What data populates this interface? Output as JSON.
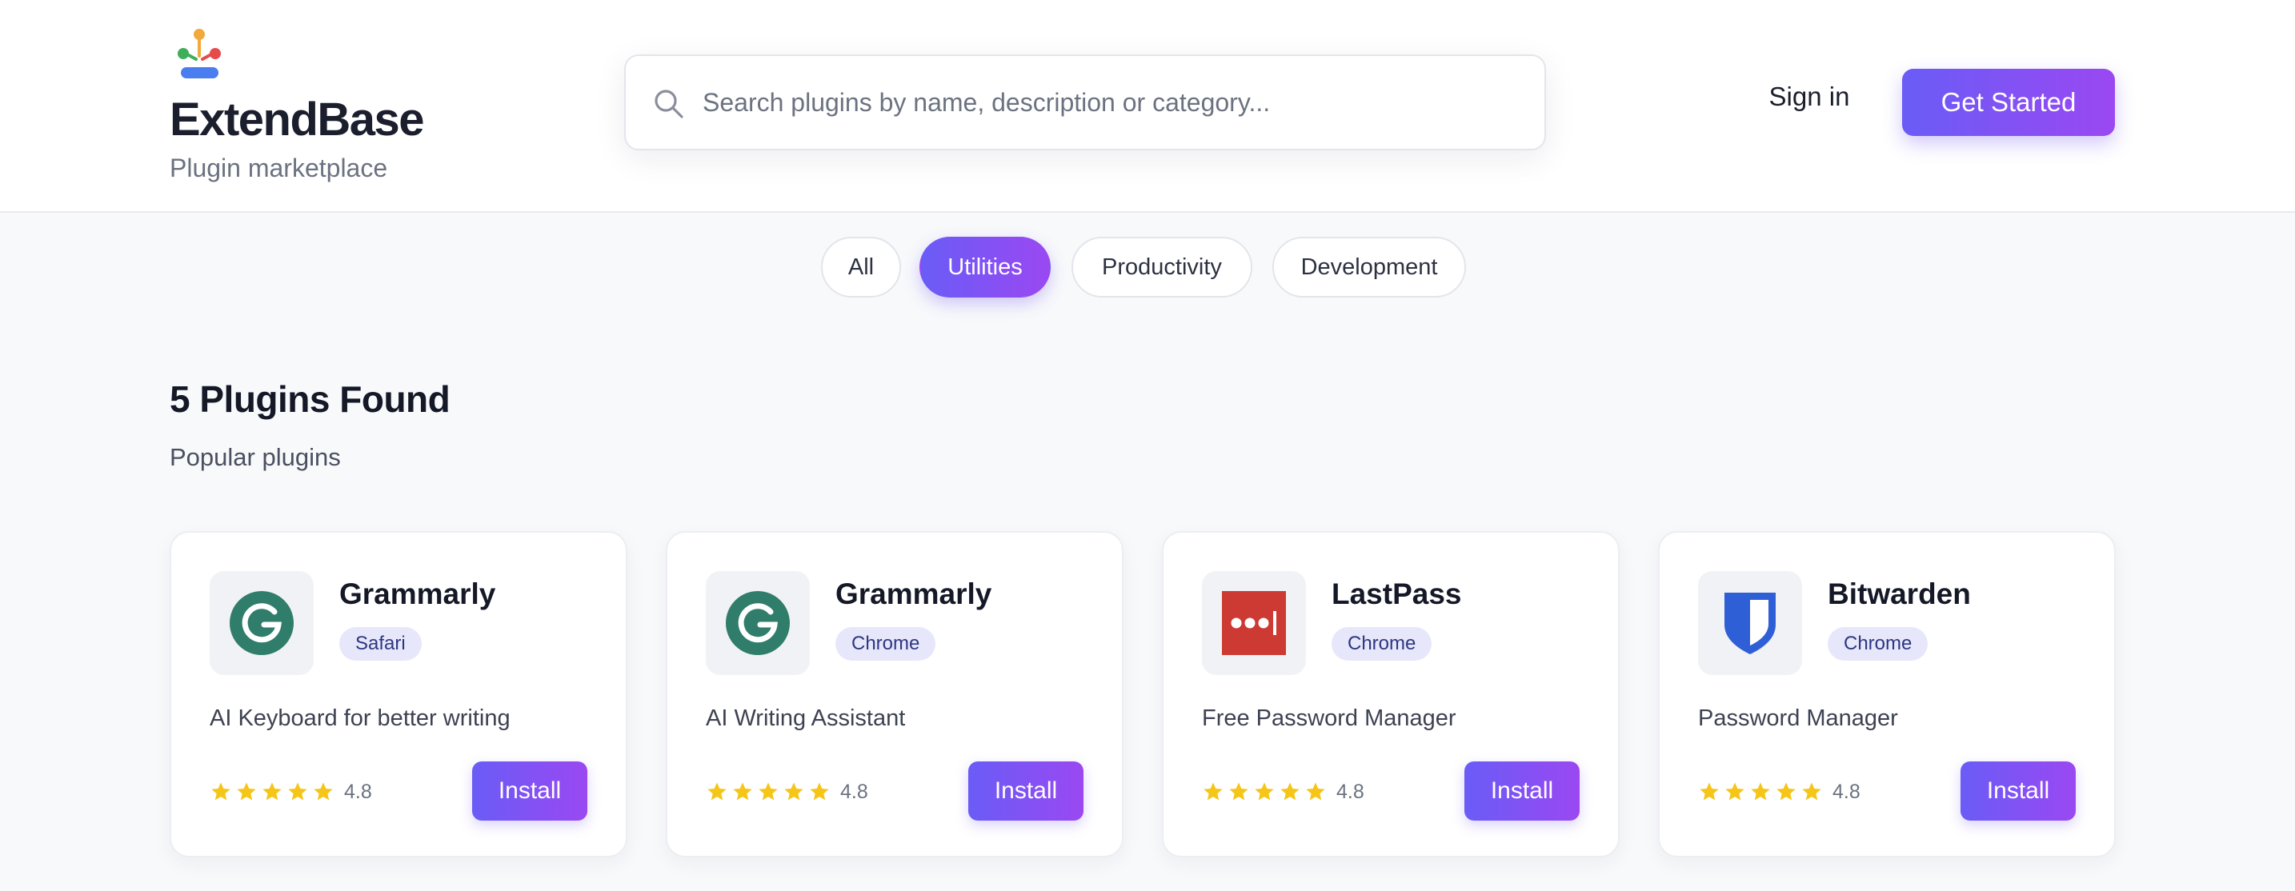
{
  "brand": {
    "name": "ExtendBase",
    "subtitle": "Plugin marketplace",
    "logo_icon": "marketplace-logo-icon"
  },
  "search": {
    "placeholder": "Search plugins by name, description or category...",
    "value": "",
    "icon": "search-icon"
  },
  "nav": {
    "sign_in": "Sign in",
    "get_started": "Get Started"
  },
  "filters": [
    {
      "label": "All",
      "active": false
    },
    {
      "label": "Utilities",
      "active": true
    },
    {
      "label": "Productivity",
      "active": false
    },
    {
      "label": "Development",
      "active": false
    }
  ],
  "results": {
    "title": "5 Plugins Found",
    "subtitle": "Popular plugins"
  },
  "plugins": [
    {
      "name": "Grammarly",
      "browser": "Safari",
      "description": "AI Keyboard for better writing",
      "rating": "4.8",
      "stars": 5,
      "install_label": "Install",
      "icon": "grammarly-icon"
    },
    {
      "name": "Grammarly",
      "browser": "Chrome",
      "description": "AI Writing Assistant",
      "rating": "4.8",
      "stars": 5,
      "install_label": "Install",
      "icon": "grammarly-icon"
    },
    {
      "name": "LastPass",
      "browser": "Chrome",
      "description": "Free Password Manager",
      "rating": "4.8",
      "stars": 5,
      "install_label": "Install",
      "icon": "lastpass-icon"
    },
    {
      "name": "Bitwarden",
      "browser": "Chrome",
      "description": "Password Manager",
      "rating": "4.8",
      "stars": 5,
      "install_label": "Install",
      "icon": "bitwarden-shield-icon"
    }
  ],
  "colors": {
    "accent_start": "#6a5cf6",
    "accent_end": "#9a48f2",
    "badge_bg": "#e6e7fb",
    "star": "#f5c518",
    "grammarly": "#2f7d6a",
    "lastpass": "#cc3a33",
    "bitwarden": "#2f5fd6"
  }
}
